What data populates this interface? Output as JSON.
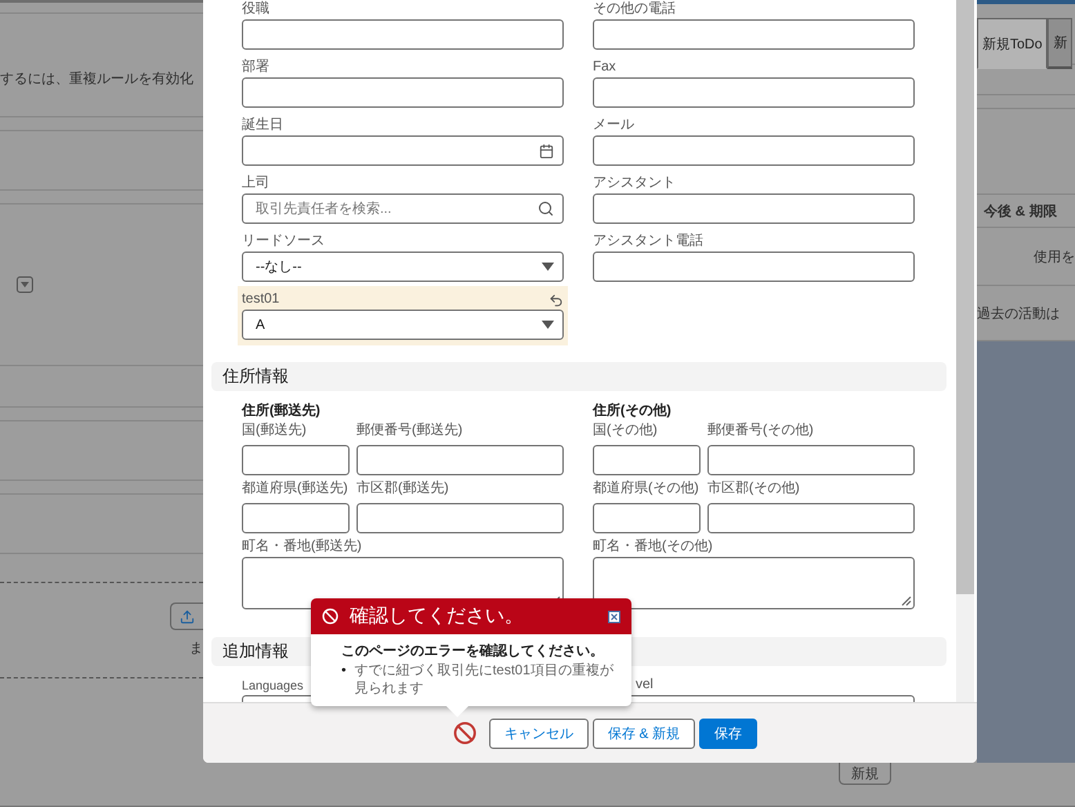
{
  "background": {
    "notice": "するには、重複ルールを有効化",
    "upload_caption": "ま",
    "tabs": [
      {
        "label": "新規ToDo",
        "selected": true
      },
      {
        "label": "新",
        "selected": false
      }
    ],
    "activity_header": "今後 & 期限",
    "activity_hint": "使用を",
    "past_activity": "過去の活動は",
    "new_button": "新規"
  },
  "form": {
    "rows": [
      [
        {
          "label": "役職",
          "kind": "text"
        },
        {
          "label": "その他の電話",
          "kind": "text"
        }
      ],
      [
        {
          "label": "部署",
          "kind": "text"
        },
        {
          "label": "Fax",
          "kind": "text"
        }
      ],
      [
        {
          "label": "誕生日",
          "kind": "date"
        },
        {
          "label": "メール",
          "kind": "text"
        }
      ],
      [
        {
          "label": "上司",
          "kind": "lookup",
          "placeholder": "取引先責任者を検索..."
        },
        {
          "label": "アシスタント",
          "kind": "text"
        }
      ],
      [
        {
          "label": "リードソース",
          "kind": "select",
          "value": "--なし--"
        },
        {
          "label": "アシスタント電話",
          "kind": "text"
        }
      ],
      [
        {
          "label": "test01",
          "kind": "select",
          "value": "A",
          "changed": true
        }
      ]
    ],
    "address_section": {
      "title": "住所情報",
      "columns": [
        {
          "title": "住所(郵送先)",
          "country": "国(郵送先)",
          "postal_code": "郵便番号(郵送先)",
          "state": "都道府県(郵送先)",
          "city": "市区郡(郵送先)",
          "street": "町名・番地(郵送先)"
        },
        {
          "title": "住所(その他)",
          "country": "国(その他)",
          "postal_code": "郵便番号(その他)",
          "state": "都道府県(その他)",
          "city": "市区郡(その他)",
          "street": "町名・番地(その他)"
        }
      ]
    },
    "extra_section": {
      "title": "追加情報",
      "languages_label": "Languages",
      "level_label": "vel"
    }
  },
  "footer": {
    "buttons": [
      {
        "label": "キャンセル",
        "primary": false
      },
      {
        "label": "保存 & 新規",
        "primary": false
      },
      {
        "label": "保存",
        "primary": true
      }
    ]
  },
  "error_popover": {
    "title": "確認してください。",
    "message": "このページのエラーを確認してください。",
    "bullet": "•",
    "errors": [
      "すでに紐づく取引先にtest01項目の重複が見られます"
    ]
  }
}
